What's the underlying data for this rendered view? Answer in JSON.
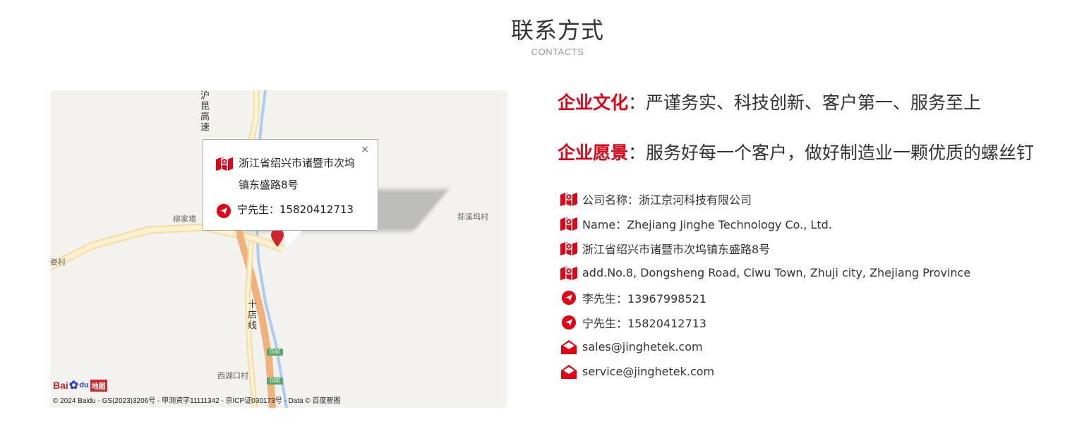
{
  "section": {
    "title": "联系方式",
    "subtitle": "CONTACTS"
  },
  "map": {
    "labels": {
      "highway": "沪昆高速",
      "liujiata": "柳家塔",
      "xixiwucun": "荪溪坞村",
      "loucun": "娄村",
      "shidianxian": "十店线",
      "xihukoucun": "西湖口村",
      "g60a": "G60",
      "g60b": "G60"
    },
    "infowindow": {
      "close": "×",
      "address": "浙江省绍兴市诸暨市次坞镇东盛路8号",
      "address_line1": "浙江省绍兴市诸暨市次坞",
      "address_line2": "镇东盛路8号",
      "contact": "宁先生：15820412713"
    },
    "logo": {
      "bai": "Bai",
      "du": "du",
      "ditu": "地图"
    },
    "copyright": "© 2024 Baidu - GS(2023)3206号 - 甲测资字11111342 - 京ICP证030173号 - Data © 百度智图"
  },
  "company": {
    "culture_label": "企业文化",
    "culture_text": "：严谨务实、科技创新、客户第一、服务至上",
    "vision_label": "企业愿景",
    "vision_text": "：服务好每一个客户，做好制造业一颗优质的螺丝钉"
  },
  "contacts": [
    {
      "icon": "map-icon",
      "text": "公司名称：浙江京河科技有限公司"
    },
    {
      "icon": "map-icon",
      "text": "Name：Zhejiang Jinghe Technology Co., Ltd."
    },
    {
      "icon": "map-icon",
      "text": "浙江省绍兴市诸暨市次坞镇东盛路8号"
    },
    {
      "icon": "map-icon",
      "text": "add.No.8, Dongsheng Road, Ciwu Town, Zhuji city, Zhejiang Province"
    },
    {
      "icon": "phone-icon",
      "text": "李先生：13967998521"
    },
    {
      "icon": "phone-icon",
      "text": "宁先生：15820412713"
    },
    {
      "icon": "mail-icon",
      "text": "sales@jinghetek.com"
    },
    {
      "icon": "mail-icon",
      "text": "service@jinghetek.com"
    }
  ],
  "colors": {
    "accent": "#e60012",
    "text": "#333333",
    "subtitle": "#999999"
  }
}
